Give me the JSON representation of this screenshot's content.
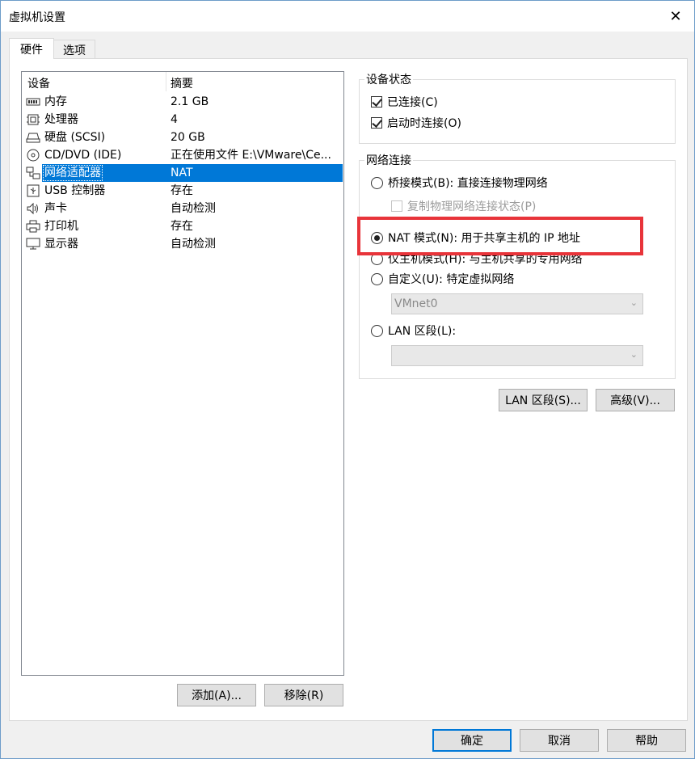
{
  "window": {
    "title": "虚拟机设置",
    "close_glyph": "✕"
  },
  "tabs": [
    {
      "label": "硬件"
    },
    {
      "label": "选项"
    }
  ],
  "device_list": {
    "col_device": "设备",
    "col_summary": "摘要",
    "rows": [
      {
        "icon": "memory-icon",
        "name": "内存",
        "summary": "2.1 GB"
      },
      {
        "icon": "processor-icon",
        "name": "处理器",
        "summary": "4"
      },
      {
        "icon": "harddisk-icon",
        "name": "硬盘 (SCSI)",
        "summary": "20 GB"
      },
      {
        "icon": "cd-dvd-icon",
        "name": "CD/DVD (IDE)",
        "summary": "正在使用文件 E:\\VMware\\Ce..."
      },
      {
        "icon": "network-adapter-icon",
        "name": "网络适配器",
        "summary": "NAT"
      },
      {
        "icon": "usb-icon",
        "name": "USB 控制器",
        "summary": "存在"
      },
      {
        "icon": "sound-icon",
        "name": "声卡",
        "summary": "自动检测"
      },
      {
        "icon": "printer-icon",
        "name": "打印机",
        "summary": "存在"
      },
      {
        "icon": "display-icon",
        "name": "显示器",
        "summary": "自动检测"
      }
    ],
    "selected_index": 4
  },
  "buttons": {
    "add": "添加(A)...",
    "remove": "移除(R)",
    "lan_segments": "LAN 区段(S)...",
    "advanced": "高级(V)...",
    "ok": "确定",
    "cancel": "取消",
    "help": "帮助"
  },
  "device_status": {
    "legend": "设备状态",
    "connected": {
      "label": "已连接(C)",
      "checked": true
    },
    "connect_at_power_on": {
      "label": "启动时连接(O)",
      "checked": true
    }
  },
  "network_connection": {
    "legend": "网络连接",
    "bridged": {
      "label": "桥接模式(B): 直接连接物理网络",
      "selected": false
    },
    "replicate_state": {
      "label": "复制物理网络连接状态(P)",
      "checked": false,
      "enabled": false
    },
    "nat": {
      "label": "NAT 模式(N): 用于共享主机的 IP 地址",
      "selected": true
    },
    "host_only": {
      "label": "仅主机模式(H): 与主机共享的专用网络",
      "selected": false
    },
    "custom": {
      "label": "自定义(U): 特定虚拟网络",
      "selected": false,
      "value": "VMnet0"
    },
    "lan_segment": {
      "label": "LAN 区段(L):",
      "selected": false,
      "value": ""
    }
  },
  "colors": {
    "selection": "#0078d7",
    "highlight_box": "#e8343a"
  }
}
